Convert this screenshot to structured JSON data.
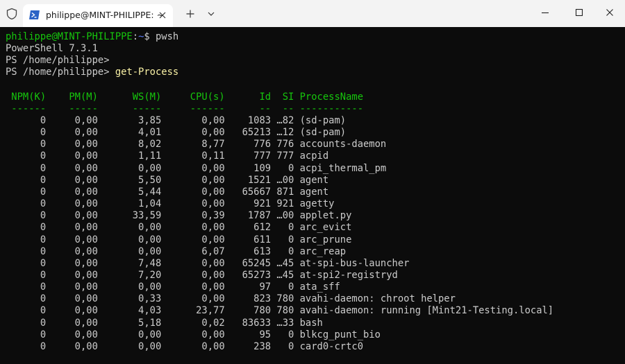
{
  "titlebar": {
    "tab_title": "philippe@MINT-PHILIPPE: ~",
    "icons": [
      "shield-icon",
      "powershell-icon",
      "close-icon",
      "plus-icon",
      "chevron-down-icon",
      "minimize-icon",
      "maximize-icon",
      "close-window-icon"
    ]
  },
  "colors": {
    "prompt_user": "#16c60c",
    "prompt_path": "#3b78ff",
    "command": "#f9f1a5",
    "text": "#cccccc",
    "header": "#16c60c",
    "background": "#0c0c0c"
  },
  "terminal": {
    "prompt": {
      "user_host": "philippe@MINT-PHILIPPE",
      "colon": ":",
      "path": "~",
      "dollar": "$ ",
      "command": "pwsh"
    },
    "version_line": "PowerShell 7.3.1",
    "ps_prompt_1": "PS /home/philippe>",
    "ps_prompt_2": "PS /home/philippe> ",
    "ps_command": "get-Process",
    "header_line": " NPM(K)    PM(M)      WS(M)     CPU(s)      Id  SI ProcessName",
    "underline_line": " ------    -----      -----     ------      --  -- -----------",
    "rows": [
      "      0     0,00       3,85       0,00    1083 …82 (sd-pam)",
      "      0     0,00       4,01       0,00   65213 …12 (sd-pam)",
      "      0     0,00       8,02       8,77     776 776 accounts-daemon",
      "      0     0,00       1,11       0,11     777 777 acpid",
      "      0     0,00       0,00       0,00     109   0 acpi_thermal_pm",
      "      0     0,00       5,50       0,00    1521 …00 agent",
      "      0     0,00       5,44       0,00   65667 871 agent",
      "      0     0,00       1,04       0,00     921 921 agetty",
      "      0     0,00      33,59       0,39    1787 …00 applet.py",
      "      0     0,00       0,00       0,00     612   0 arc_evict",
      "      0     0,00       0,00       0,00     611   0 arc_prune",
      "      0     0,00       0,00       6,07     613   0 arc_reap",
      "      0     0,00       7,48       0,00   65245 …45 at-spi-bus-launcher",
      "      0     0,00       7,20       0,00   65273 …45 at-spi2-registryd",
      "      0     0,00       0,00       0,00      97   0 ata_sff",
      "      0     0,00       0,33       0,00     823 780 avahi-daemon: chroot helper",
      "      0     0,00       4,03      23,77     780 780 avahi-daemon: running [Mint21-Testing.local]",
      "      0     0,00       5,18       0,02   83633 …33 bash",
      "      0     0,00       0,00       0,00      95   0 blkcg_punt_bio",
      "      0     0,00       0,00       0,00     238   0 card0-crtc0"
    ]
  }
}
